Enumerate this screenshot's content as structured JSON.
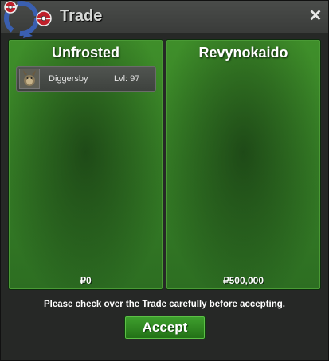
{
  "window": {
    "title": "Trade",
    "close_label": "✕"
  },
  "trade": {
    "left": {
      "name": "Unfrosted",
      "money": "₽0",
      "items": [
        {
          "name": "Diggersby",
          "level": "Lvl: 97",
          "icon": "pokemon-icon"
        }
      ]
    },
    "right": {
      "name": "Revynokaido",
      "money": "₽500,000",
      "items": []
    },
    "notice": "Please check over the Trade carefully before accepting.",
    "accept_label": "Accept"
  },
  "colors": {
    "panel_green": "#3a8a28",
    "accept_green": "#2f8c22",
    "title_text": "#d6d8d6"
  }
}
